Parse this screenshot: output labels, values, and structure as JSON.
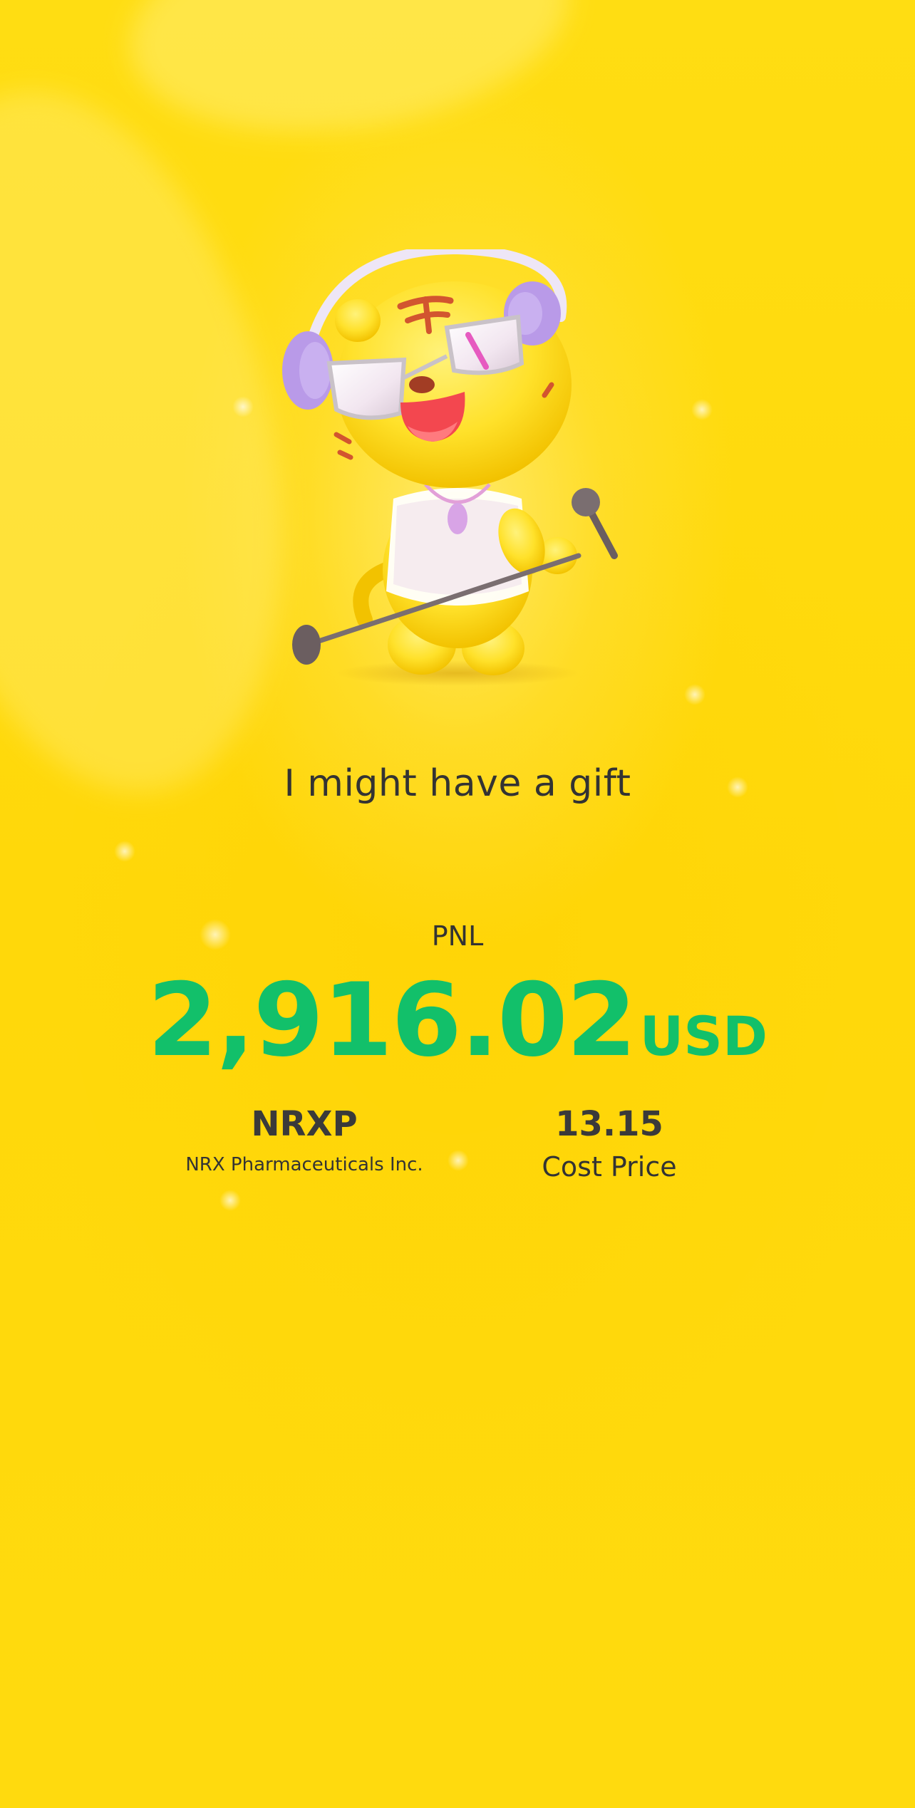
{
  "colors": {
    "background": "#FFDB0A",
    "profit_green": "#12C06A",
    "text_dark": "#333333"
  },
  "mascot": {
    "icon": "tiger-mascot-with-headphones-and-microphone-icon"
  },
  "headline": "I might have a gift",
  "pnl": {
    "label": "PNL",
    "value": "2,916.02",
    "unit": "USD"
  },
  "stock": {
    "ticker": "NRXP",
    "company_name": "NRX Pharmaceuticals Inc."
  },
  "cost": {
    "value": "13.15",
    "label": "Cost Price"
  }
}
